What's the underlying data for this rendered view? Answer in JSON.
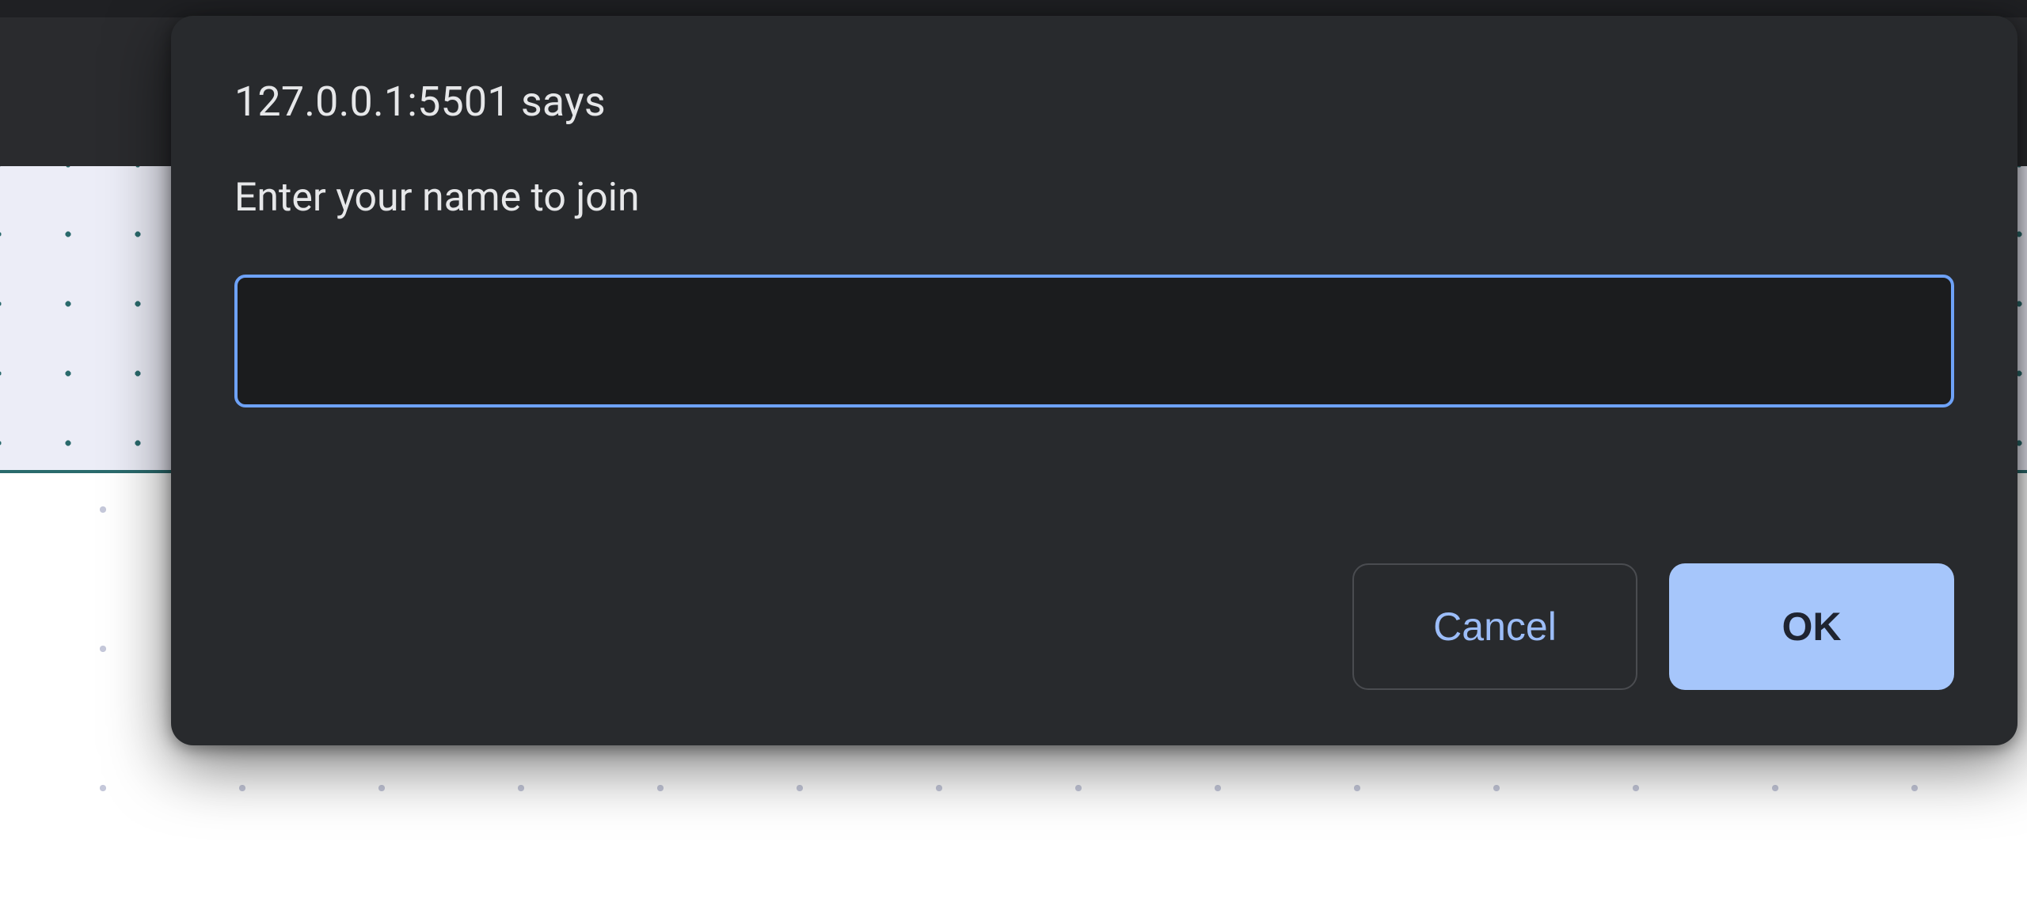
{
  "dialog": {
    "origin": "127.0.0.1:5501 says",
    "message": "Enter your name to join",
    "input_value": "",
    "buttons": {
      "cancel": "Cancel",
      "ok": "OK"
    }
  }
}
